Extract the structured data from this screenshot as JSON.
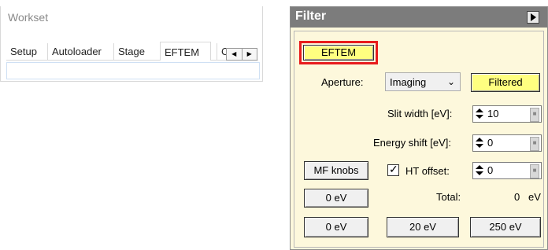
{
  "workset": {
    "title": "Workset",
    "tabs": [
      "Setup",
      "Autoloader",
      "Stage",
      "EFTEM",
      "C"
    ],
    "active_tab": "EFTEM"
  },
  "filter": {
    "title": "Filter",
    "mode_button": "EFTEM",
    "aperture_label": "Aperture:",
    "aperture_value": "Imaging",
    "filtered_button": "Filtered",
    "slit_width_label": "Slit width [eV]:",
    "slit_width_value": "10",
    "energy_shift_label": "Energy shift [eV]:",
    "energy_shift_value": "0",
    "mf_knobs_button": "MF knobs",
    "ht_offset_label": "HT offset:",
    "ht_offset_checked": true,
    "ht_offset_value": "0",
    "left_btn_1": "0 eV",
    "total_label": "Total:",
    "total_value": "0",
    "total_unit": "eV",
    "bottom_buttons": [
      "0 eV",
      "20 eV",
      "250 eV"
    ],
    "highlight_color": "#e81c1c",
    "button_yellow": "#ffff80",
    "panel_bg": "#fdf8dc"
  }
}
